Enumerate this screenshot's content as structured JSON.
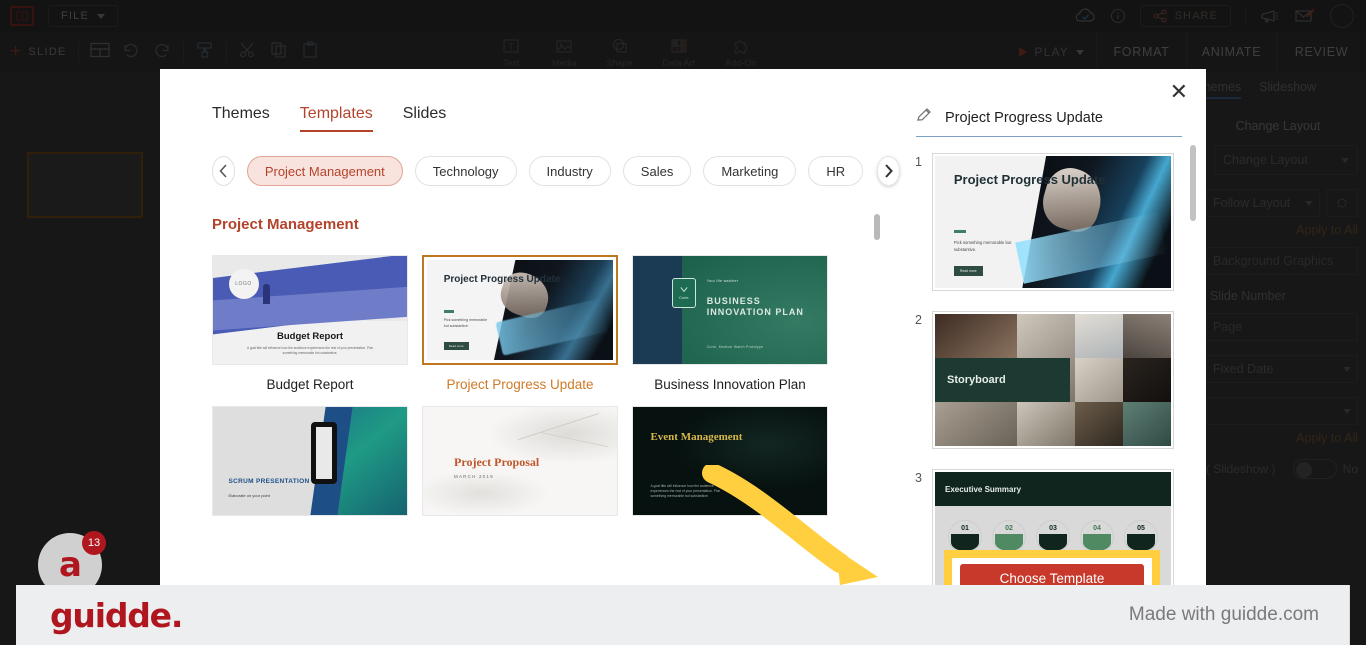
{
  "app": {
    "file_menu": "FILE",
    "toolbar_left": {
      "add_slide": "SLIDE"
    },
    "toolbar_center": [
      {
        "label": "Text",
        "icon": "text-icon"
      },
      {
        "label": "Media",
        "icon": "media-icon"
      },
      {
        "label": "Shape",
        "icon": "shape-icon"
      },
      {
        "label": "Data Art",
        "icon": "data-art-icon"
      },
      {
        "label": "Add-On",
        "icon": "add-on-icon"
      }
    ],
    "share_label": "SHARE",
    "play_label": "PLAY",
    "ribbon_tabs": [
      "FORMAT",
      "ANIMATE",
      "REVIEW"
    ]
  },
  "right_panel": {
    "tabs": [
      "Themes",
      "Slideshow"
    ],
    "section_title": "Change Layout",
    "change_layout_select": "Change Layout",
    "follow_layout": "Follow Layout",
    "apply_to_all": "Apply to All",
    "background_graphics": "Background Graphics",
    "slide_number_label": "Slide Number",
    "page_value": "Page",
    "fixed_date": "Fixed Date",
    "apply_to_all_2": "Apply to All",
    "slideshow_label": "( Slideshow )",
    "toggle_value": "No"
  },
  "modal": {
    "close_icon": "close-icon",
    "tabs": [
      {
        "label": "Themes",
        "active": false
      },
      {
        "label": "Templates",
        "active": true
      },
      {
        "label": "Slides",
        "active": false
      }
    ],
    "categories": [
      {
        "label": "Project Management",
        "active": true
      },
      {
        "label": "Technology",
        "active": false
      },
      {
        "label": "Industry",
        "active": false
      },
      {
        "label": "Sales",
        "active": false
      },
      {
        "label": "Marketing",
        "active": false
      },
      {
        "label": "HR",
        "active": false
      }
    ],
    "prev_icon": "chevron-left-icon",
    "next_icon": "chevron-right-icon",
    "section_title": "Project Management",
    "templates": [
      {
        "label": "Budget Report",
        "selected": false,
        "slide": {
          "title": "Budget Report",
          "logo": "LOGO",
          "body": "A goal title will influence how the audience experiences the rest of your presentation. Pick something memorable but substantive."
        }
      },
      {
        "label": "Project Progress Update",
        "selected": true,
        "slide": {
          "title": "Project Progress Update",
          "body": "Pick something memorable but substantive.",
          "button": "Read more"
        }
      },
      {
        "label": "Business Innovation Plan",
        "selected": false,
        "slide": {
          "tagline": "Your life watcher",
          "title": "BUSINESS INNOVATION PLAN",
          "sub": "Corie, Medical Watch Prototype",
          "badge": "Corie"
        }
      },
      {
        "label": "",
        "selected": false,
        "slide": {
          "title": "SCRUM PRESENTATION",
          "sub": "Elaborate on your point"
        }
      },
      {
        "label": "",
        "selected": false,
        "slide": {
          "title": "Project Proposal",
          "date": "MARCH 2019"
        }
      },
      {
        "label": "",
        "selected": false,
        "slide": {
          "title": "Event Management",
          "body": "A goal title will influence how the audience experiences the rest of your presentation. Pick something memorable but substantive."
        }
      }
    ],
    "preview": {
      "edit_icon": "pencil-icon",
      "title": "Project Progress Update",
      "slides": [
        {
          "number": "1",
          "kind": "title-slide",
          "title": "Project Progress Update",
          "body": "Pick something memorable but substantive.",
          "button": "Read more"
        },
        {
          "number": "2",
          "kind": "storyboard",
          "title": "Storyboard"
        },
        {
          "number": "3",
          "kind": "executive-summary",
          "title": "Executive Summary",
          "steps": [
            "01",
            "02",
            "03",
            "04",
            "05"
          ]
        }
      ]
    }
  },
  "callout": {
    "arrow_color": "#ffcf3f",
    "highlight_color": "#ffcf3f",
    "button_label": "Choose Template",
    "button_color": "#c8392c"
  },
  "banner": {
    "logo_text": "guidde.",
    "made_with": "Made with guidde.com",
    "badge_letter": "a",
    "badge_count": "13"
  },
  "colors": {
    "accent_red": "#b4432b",
    "selected_orange": "#c07722",
    "highlight_yellow": "#ffcf3f"
  }
}
